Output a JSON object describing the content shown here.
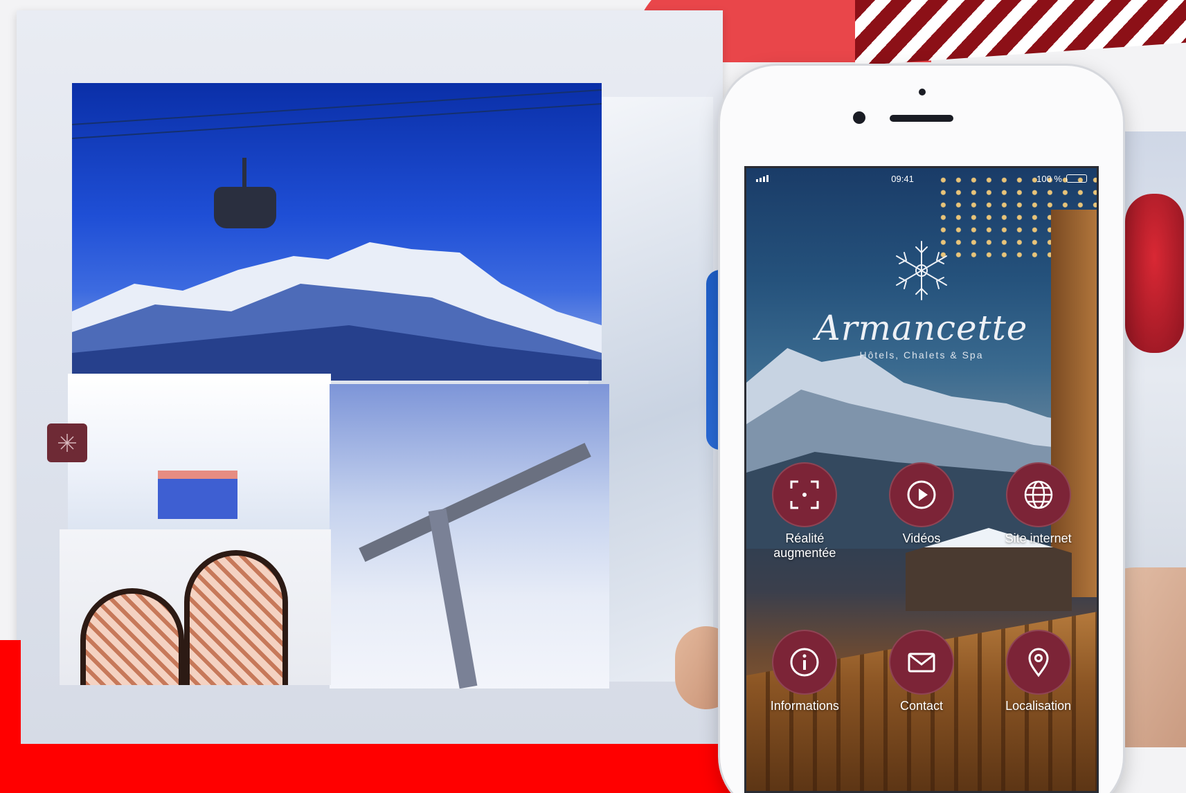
{
  "status_bar": {
    "time": "09:41",
    "battery": "100 %"
  },
  "app": {
    "brand": "Armancette",
    "tagline": "Hôtels, Chalets & Spa"
  },
  "actions": [
    {
      "label": "Réalité augmentée",
      "icon": "ar-scan-icon"
    },
    {
      "label": "Vidéos",
      "icon": "play-icon"
    },
    {
      "label": "Site internet",
      "icon": "globe-icon"
    },
    {
      "label": "Informations",
      "icon": "info-icon"
    },
    {
      "label": "Contact",
      "icon": "mail-icon"
    },
    {
      "label": "Localisation",
      "icon": "location-pin-icon"
    }
  ],
  "colors": {
    "action_circle": "#7c2437",
    "accent_red": "#ff0000",
    "stripe_dark": "#8c1017"
  }
}
